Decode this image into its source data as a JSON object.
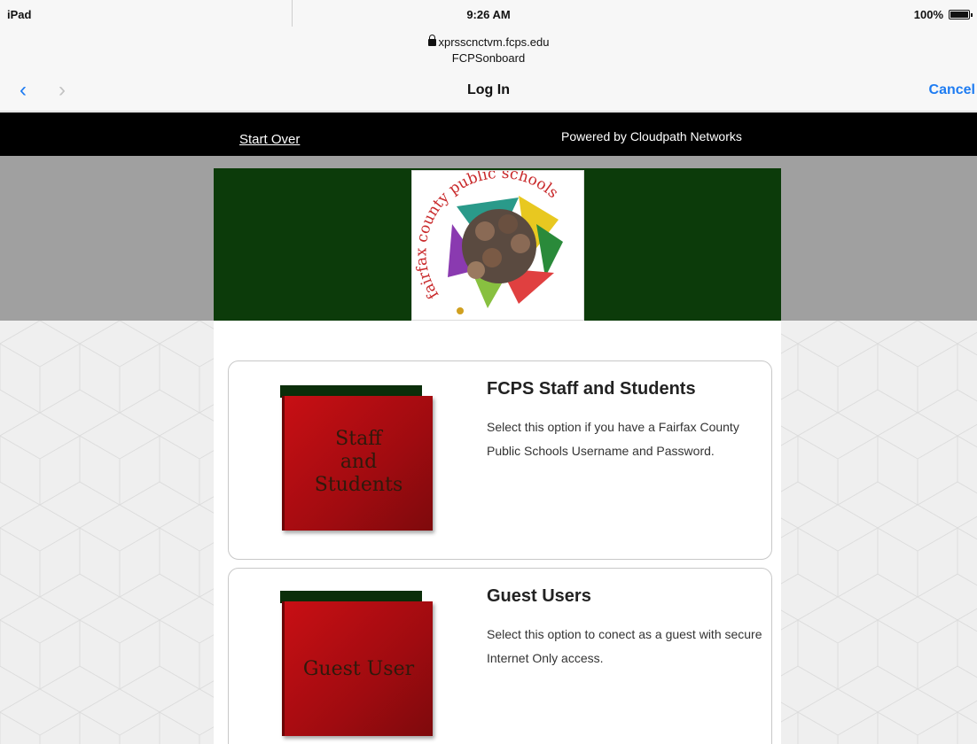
{
  "statusbar": {
    "device": "iPad",
    "time": "9:26 AM",
    "battery": "100%"
  },
  "urlbar": {
    "host": "xprsscnctvm.fcps.edu",
    "site": "FCPSonboard"
  },
  "navbar": {
    "back_glyph": "‹",
    "forward_glyph": "›",
    "title": "Log In",
    "cancel": "Cancel"
  },
  "header": {
    "start_over": "Start Over",
    "powered_by": "Powered by Cloudpath Networks"
  },
  "logo": {
    "text": "fairfax county public schools",
    "icon": "fcps-logo"
  },
  "colors": {
    "accent": "#1e7cf2",
    "green": "#0c3b0a",
    "binder_red": "#c80f14"
  },
  "options": [
    {
      "binder_label_lines": [
        "Staff",
        "and",
        "Students"
      ],
      "title": "FCPS Staff and Students",
      "description": "Select this option if you have a Fairfax County Public Schools Username and Password."
    },
    {
      "binder_label_lines": [
        "Guest User"
      ],
      "title": "Guest Users",
      "description": "Select this option to conect as a guest with secure Internet Only access."
    }
  ]
}
